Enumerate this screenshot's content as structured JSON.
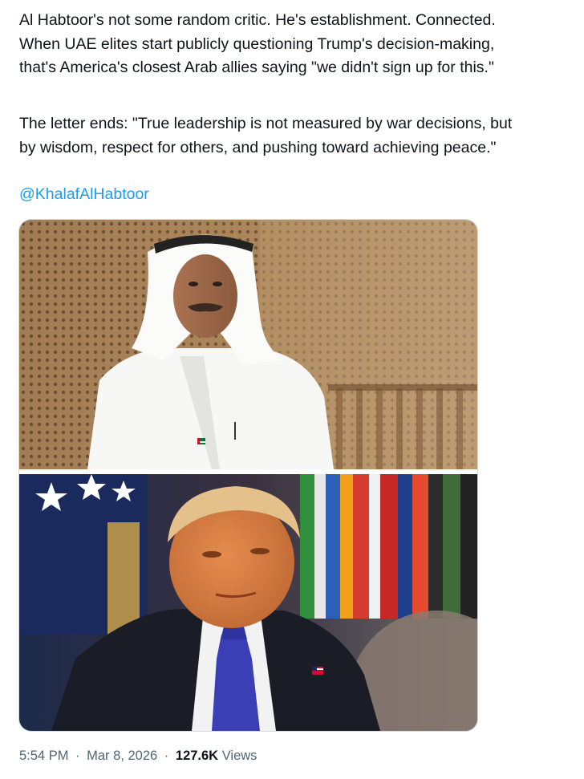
{
  "tweet": {
    "paragraph1": [
      "Al Habtoor's not some random critic. He's establishment. Connected.",
      "When UAE elites start publicly questioning Trump's decision-making,",
      "that's America's closest Arab allies saying \"we didn't sign up for this.\""
    ],
    "paragraph2": [
      "The letter ends: \"True leadership is not measured by war decisions, but",
      "by wisdom, respect for others, and pushing toward achieving peace.\""
    ],
    "mention": "@KhalafAlHabtoor"
  },
  "media": {
    "photos": [
      {
        "subject": "man-in-white-kandura-photo"
      },
      {
        "subject": "man-in-dark-suit-photo"
      }
    ]
  },
  "meta": {
    "time": "5:54 PM",
    "separator": "·",
    "date": "Mar 8, 2026",
    "views_count": "127.6K",
    "views_label": "Views"
  },
  "colors": {
    "link": "#1d9bf0",
    "text": "#0f1419",
    "secondary": "#536471",
    "border": "#cfd9de"
  }
}
